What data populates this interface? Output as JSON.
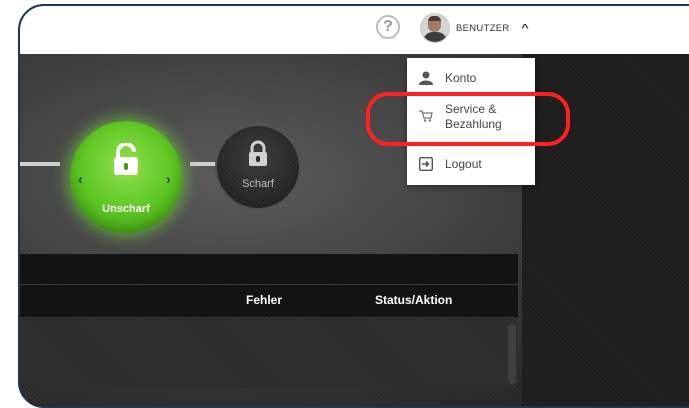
{
  "header": {
    "help_label": "?",
    "user_name": "BENUTZER",
    "caret": "^"
  },
  "user_menu": {
    "items": [
      {
        "label": "Konto",
        "icon": "user-icon"
      },
      {
        "label_line1": "Service &",
        "label_line2": "Bezahlung",
        "icon": "cart-icon"
      },
      {
        "label": "Logout",
        "icon": "logout-icon"
      }
    ]
  },
  "mode_switch": {
    "active_label": "Unscharf",
    "inactive_label": "Scharf",
    "left_arrow": "‹",
    "right_arrow": "›"
  },
  "table": {
    "columns": [
      "Fehler",
      "Status/Aktion"
    ]
  },
  "colors": {
    "highlight": "#ff2020",
    "active_green": "#59c41f",
    "frame": "#1f3550"
  }
}
